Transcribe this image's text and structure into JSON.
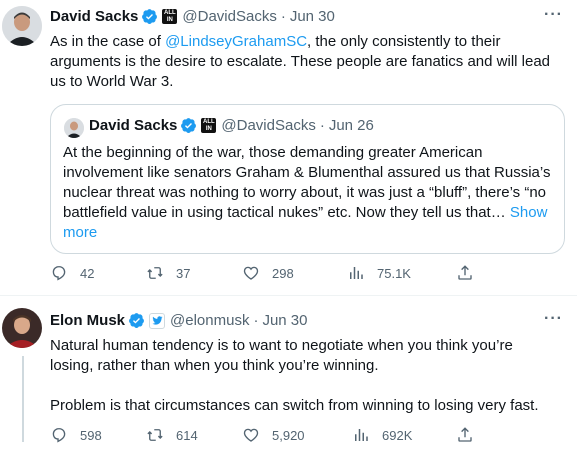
{
  "tweets": [
    {
      "author": "David Sacks",
      "affiliation_badge": "ALL IN",
      "handle": "@DavidSacks",
      "time": "Jun 30",
      "text_before": "As in the case of ",
      "mention": "@LindseyGrahamSC",
      "text_after": ", the only consistently to their arguments is the desire to escalate. These people are fanatics and will lead us to World War 3.",
      "quoted": {
        "author": "David Sacks",
        "affiliation_badge": "ALL IN",
        "handle": "@DavidSacks",
        "time": "Jun 26",
        "text": "At the beginning of the war, those demanding greater American involvement like senators Graham & Blumenthal assured us that Russia’s nuclear threat was nothing to worry about, it was just a “bluff”, there’s “no battlefield value in using tactical nukes” etc. Now they tell us that…",
        "show_more": "Show more"
      },
      "stats": {
        "replies": "42",
        "retweets": "37",
        "likes": "298",
        "views": "75.1K"
      }
    },
    {
      "author": "Elon Musk",
      "handle": "@elonmusk",
      "time": "Jun 30",
      "text_line1": "Natural human tendency is to want to negotiate when you think you’re losing, rather than when you think you’re winning.",
      "text_line2": "Problem is that circumstances can switch from winning to losing very fast.",
      "stats": {
        "replies": "598",
        "retweets": "614",
        "likes": "5,920",
        "views": "692K"
      }
    }
  ],
  "separator": "·",
  "more_glyph": "···",
  "colors": {
    "accent": "#1d9bf0",
    "secondary_text": "#536471",
    "verified": "#1d9bf0",
    "border": "#cfd9de"
  },
  "icons": [
    "verified-badge-icon",
    "reply-icon",
    "retweet-icon",
    "like-icon",
    "views-icon",
    "share-icon",
    "more-icon",
    "twitter-bird-icon"
  ]
}
